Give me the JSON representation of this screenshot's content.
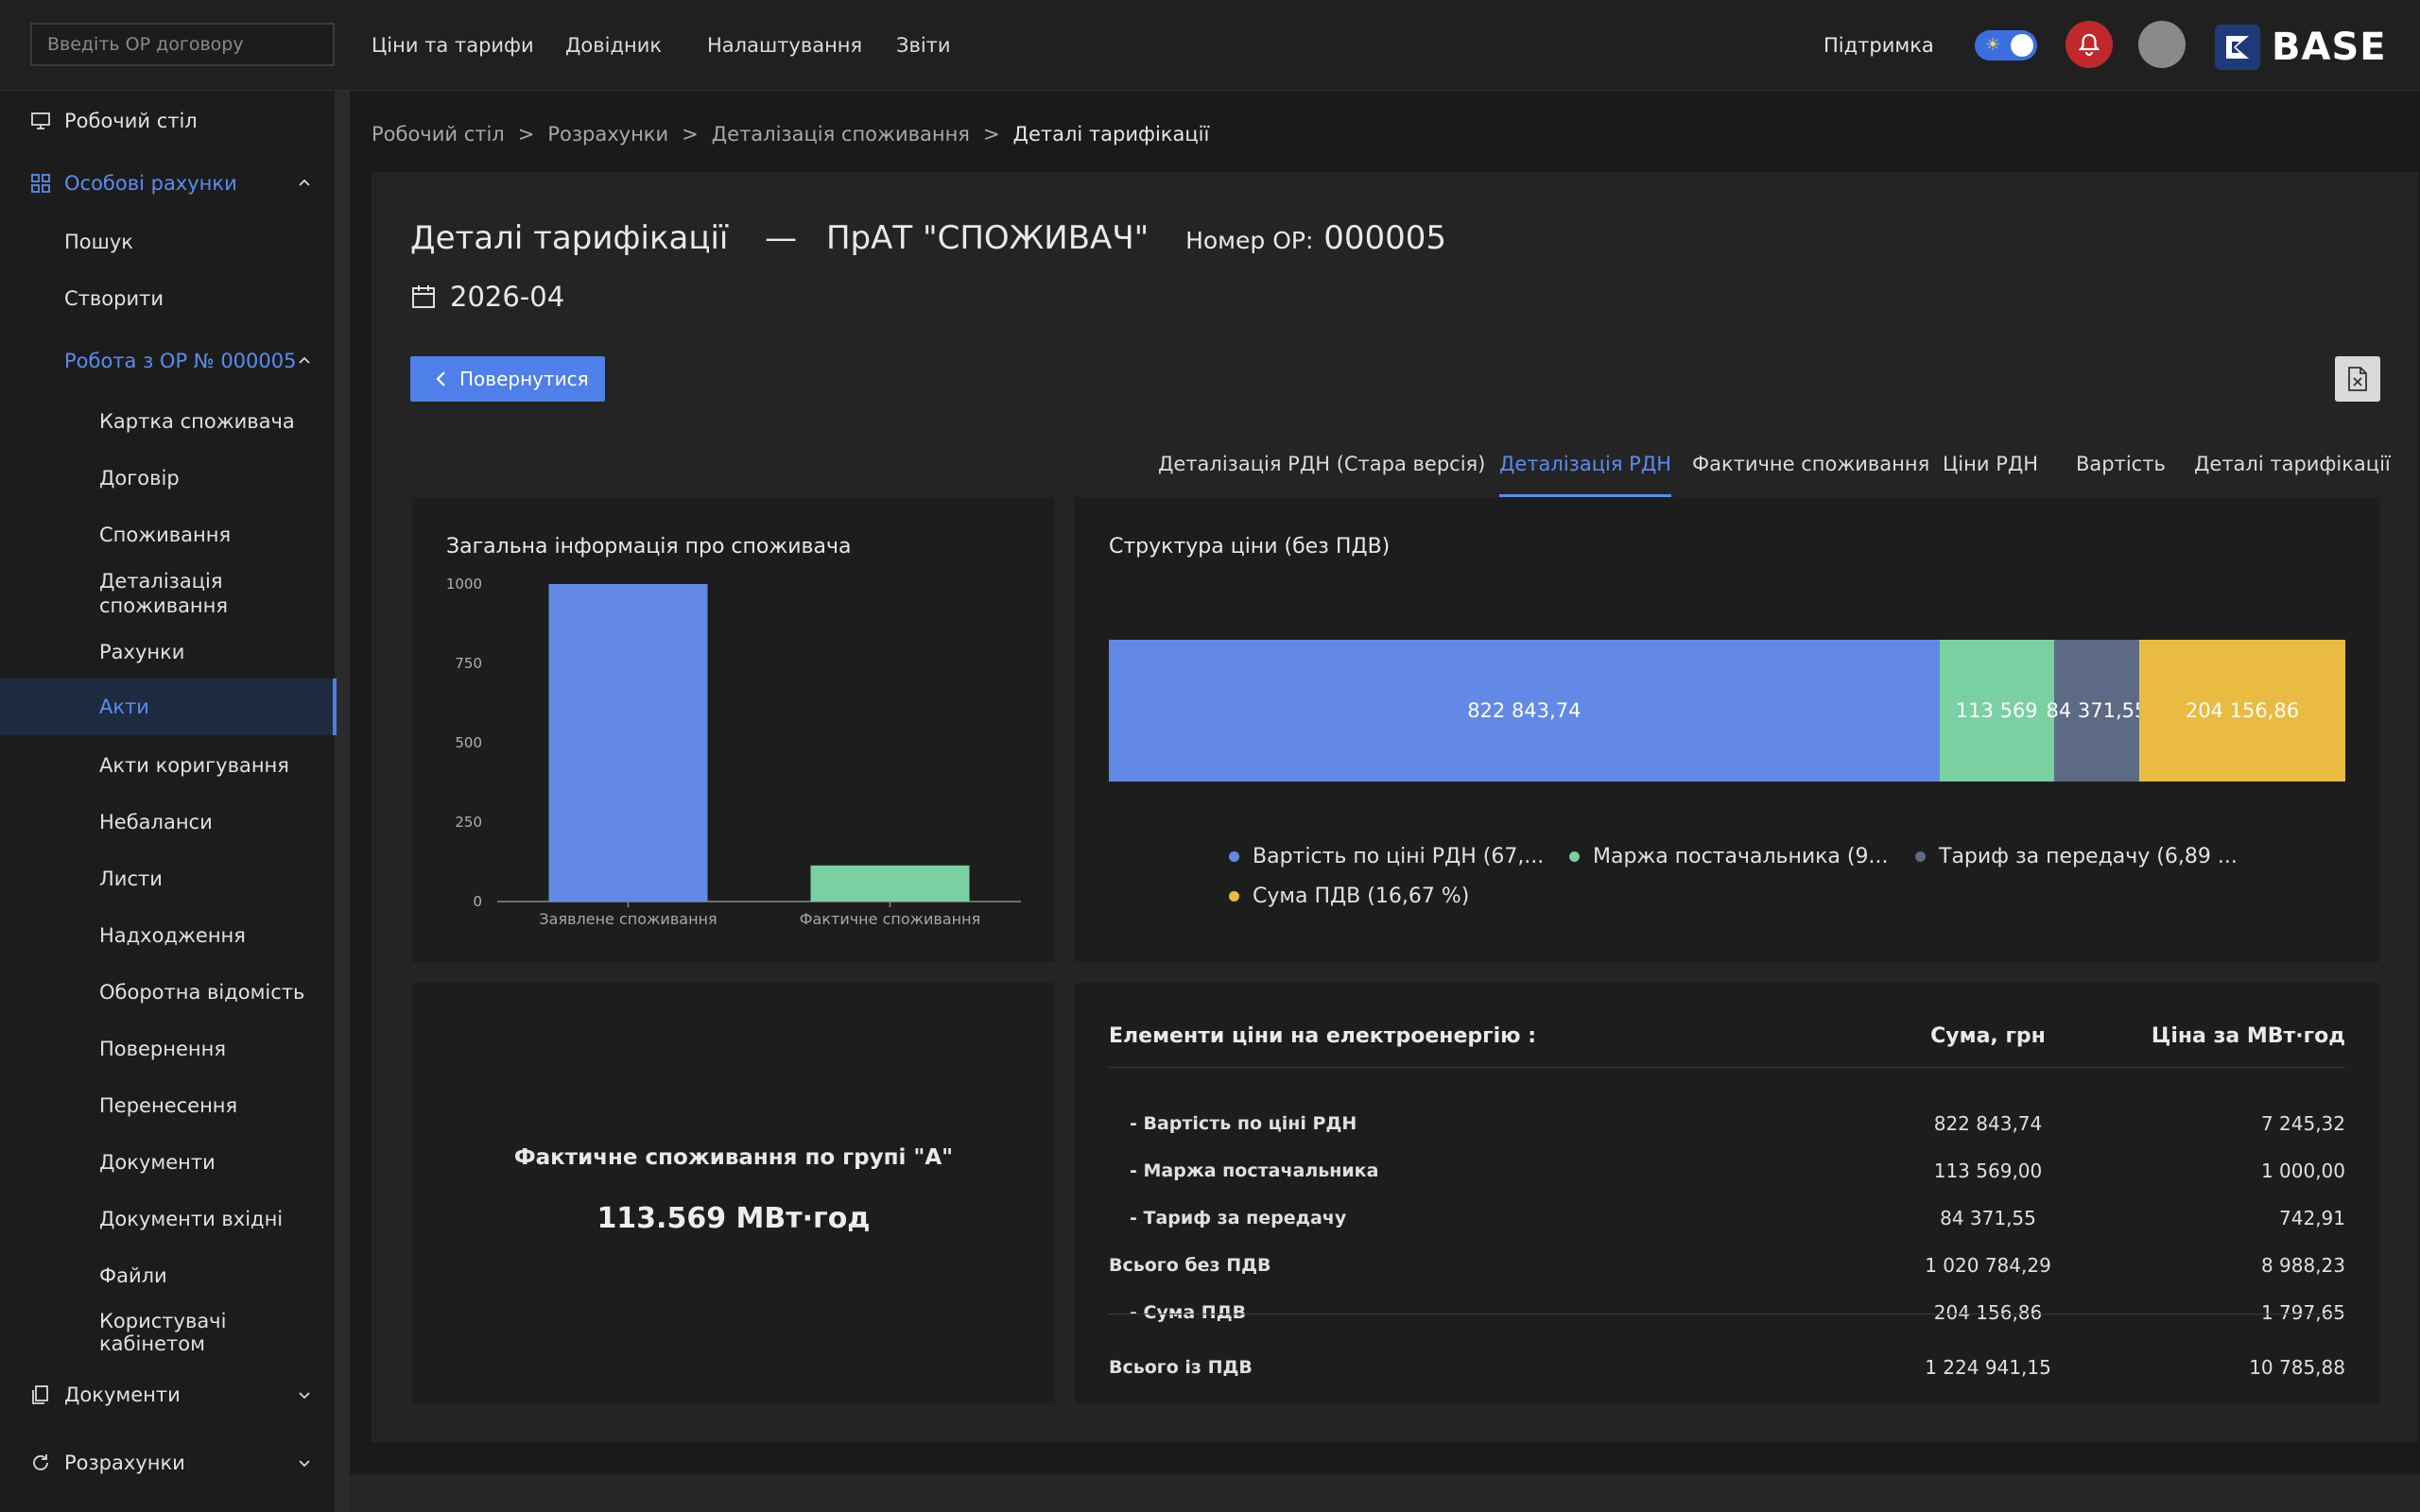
{
  "topbar": {
    "search_placeholder": "Введіть ОР договору",
    "nav": [
      "Ціни та тарифи",
      "Довідник",
      "Налаштування",
      "Звіти"
    ],
    "support": "Підтримка",
    "logo_text": "BASE"
  },
  "sidebar": {
    "items": [
      {
        "label": "Робочий стіл",
        "icon": "monitor-icon"
      },
      {
        "label": "Особові рахунки",
        "icon": "grid-icon"
      },
      {
        "label": "Пошук"
      },
      {
        "label": "Створити"
      },
      {
        "label": "Робота з ОР № 000005"
      },
      {
        "label": "Картка споживача"
      },
      {
        "label": "Договір"
      },
      {
        "label": "Споживання"
      },
      {
        "label": "Деталізація споживання"
      },
      {
        "label": "Рахунки"
      },
      {
        "label": "Акти"
      },
      {
        "label": "Акти коригування"
      },
      {
        "label": "Небаланси"
      },
      {
        "label": "Листи"
      },
      {
        "label": "Надходження"
      },
      {
        "label": "Оборотна відомість"
      },
      {
        "label": "Повернення"
      },
      {
        "label": "Перенесення"
      },
      {
        "label": "Документи"
      },
      {
        "label": "Документи вхідні"
      },
      {
        "label": "Файли"
      },
      {
        "label": "Користувачі кабінетом"
      },
      {
        "label": "Документи",
        "icon": "documents-icon"
      },
      {
        "label": "Розрахунки",
        "icon": "refresh-icon"
      }
    ]
  },
  "breadcrumbs": [
    "Робочий стіл",
    "Розрахунки",
    "Деталізація споживання",
    "Деталі тарифікації"
  ],
  "header": {
    "title": "Деталі тарифікації",
    "dash": "—",
    "company": "ПрАТ \"СПОЖИВАЧ\"",
    "number_label": "Номер ОР:",
    "number": "000005",
    "period": "2026-04"
  },
  "buttons": {
    "back": "Повернутися"
  },
  "tabs": [
    {
      "label": "Деталізація РДН (Стара версія)",
      "active": false
    },
    {
      "label": "Деталізація РДН",
      "active": true
    },
    {
      "label": "Фактичне споживання",
      "active": false
    },
    {
      "label": "Ціни РДН",
      "active": false
    },
    {
      "label": "Вартість",
      "active": false
    },
    {
      "label": "Деталі тарифікації",
      "active": false
    }
  ],
  "chart_data": [
    {
      "type": "bar",
      "title": "Загальна інформація про споживача",
      "categories": [
        "Заявлене споживання",
        "Фактичне споживання"
      ],
      "values": [
        1000,
        113.569
      ],
      "ylim": [
        0,
        1000
      ],
      "yticks": [
        1000,
        750,
        500,
        250,
        0
      ],
      "colors": [
        "#6389e6",
        "#79d0a1"
      ]
    },
    {
      "type": "bar",
      "title": "Структура ціни (без ПДВ)",
      "stacked": true,
      "orientation": "horizontal",
      "series": [
        {
          "name": "Вартість по ціні РДН (67,...",
          "value": 822843.74,
          "label": "822 843,74",
          "color": "#6389e6"
        },
        {
          "name": "Маржа постачальника (9...",
          "value": 113569,
          "label": "113 569",
          "color": "#79d0a1"
        },
        {
          "name": "Тариф за передачу (6,89 ...",
          "value": 84371.55,
          "label": "84 371,55",
          "color": "#5d6a86"
        },
        {
          "name": "Сума ПДВ (16,67 %)",
          "value": 204156.86,
          "label": "204 156,86",
          "color": "#e9bb41"
        }
      ]
    }
  ],
  "kpi": {
    "title": "Фактичне споживання по групі \"А\"",
    "value": "113.569 МВт·год"
  },
  "price_table": {
    "headers": [
      "Елементи ціни на електроенергію :",
      "Сума, грн",
      "Ціна за МВт·год"
    ],
    "rows": [
      {
        "name": "- Вартість по ціні РДН",
        "sum": "822 843,74",
        "price": "7 245,32",
        "kind": "sub"
      },
      {
        "name": "- Маржа постачальника",
        "sum": "113 569,00",
        "price": "1 000,00",
        "kind": "sub"
      },
      {
        "name": "- Тариф за передачу",
        "sum": "84 371,55",
        "price": "742,91",
        "kind": "sub"
      },
      {
        "name": "Всього без ПДВ",
        "sum": "1 020 784,29",
        "price": "8 988,23",
        "kind": "tot"
      },
      {
        "name": "- Сума ПДВ",
        "sum": "204 156,86",
        "price": "1 797,65",
        "kind": "sub"
      },
      {
        "name": "Всього із ПДВ",
        "sum": "1 224 941,15",
        "price": "10 785,88",
        "kind": "tot"
      }
    ]
  }
}
